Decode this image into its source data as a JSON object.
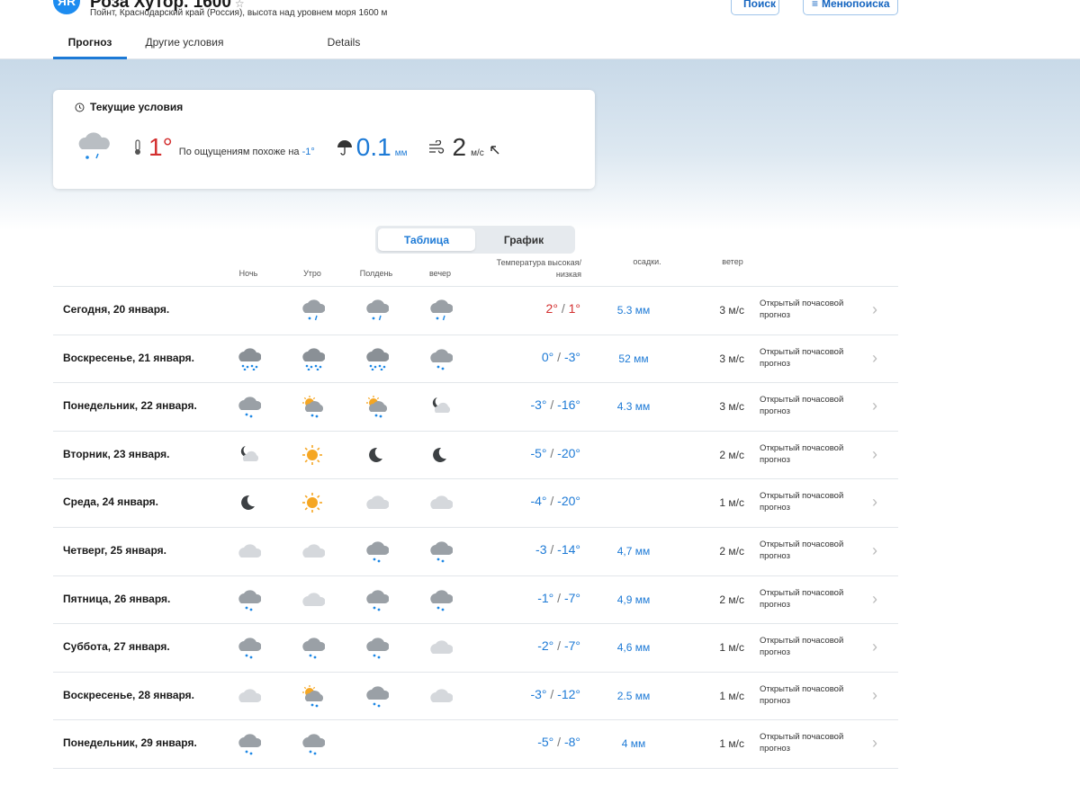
{
  "header": {
    "logo_text": "ЯR",
    "title": "Роза Хутор. 1600",
    "star": "☆",
    "subtitle": "Пойнт, Краснодарский край (Россия), высота над уровнем моря 1600 м",
    "search_label": "Поиск",
    "menu_label": "Менюпоиска"
  },
  "tabs": [
    {
      "label": "Прогноз",
      "active": true
    },
    {
      "label": "Другие условия",
      "active": false
    },
    {
      "label": "Details",
      "active": false
    }
  ],
  "current": {
    "heading": "Текущие условия",
    "icon": "cloud-light-snow-rain-icon",
    "temperature": "1°",
    "feels_like_label": "По ощущениям похоже на",
    "feels_like_value": "-1°",
    "precip_value": "0.1",
    "precip_unit": "мм",
    "wind_value": "2",
    "wind_unit": "м/с",
    "wind_direction_icon": "arrow-northwest-icon"
  },
  "view_toggle": {
    "table_label": "Таблица",
    "chart_label": "График",
    "active": "table"
  },
  "columns": {
    "night": "Ночь",
    "morning": "Утро",
    "noon": "Полдень",
    "evening": "вечер",
    "temp": "Температура высокая/\nнизкая",
    "precip": "осадки.",
    "wind": "ветер"
  },
  "days": [
    {
      "label": "Сегодня, 20 января.",
      "icons": [
        "",
        "cloud-snow-rain",
        "cloud-snow-rain",
        "cloud-snow-rain"
      ],
      "high": "2°",
      "low": "1°",
      "warm": true,
      "precip": "5.3 мм",
      "wind": "3 м/с",
      "hourly": "Открытый почасовой прогноз"
    },
    {
      "label": "Воскресенье, 21 января.",
      "icons": [
        "cloud-heavy-snow",
        "cloud-heavy-snow",
        "cloud-heavy-snow",
        "cloud-snow"
      ],
      "high": "0°",
      "low": "-3°",
      "warm": false,
      "precip": "52 мм",
      "wind": "3 м/с",
      "hourly": "Открытый почасовой прогноз"
    },
    {
      "label": "Понедельник, 22 января.",
      "icons": [
        "cloud-snow",
        "sun-cloud-snow",
        "sun-cloud-snow",
        "moon-cloud"
      ],
      "high": "-3°",
      "low": "-16°",
      "warm": false,
      "precip": "4.3 мм",
      "wind": "3 м/с",
      "hourly": "Открытый почасовой прогноз"
    },
    {
      "label": "Вторник, 23 января.",
      "icons": [
        "moon-cloud",
        "sun",
        "moon",
        "moon"
      ],
      "high": "-5°",
      "low": "-20°",
      "warm": false,
      "precip": "",
      "wind": "2 м/с",
      "hourly": "Открытый почасовой прогноз"
    },
    {
      "label": "Среда, 24 января.",
      "icons": [
        "moon",
        "sun",
        "cloud-light",
        "cloud-light"
      ],
      "high": "-4°",
      "low": "-20°",
      "warm": false,
      "precip": "",
      "wind": "1 м/с",
      "hourly": "Открытый почасовой прогноз"
    },
    {
      "label": "Четверг, 25 января.",
      "icons": [
        "cloud-light",
        "cloud-light",
        "cloud-snow",
        "cloud-snow"
      ],
      "high": "-3",
      "low": "-14°",
      "warm": false,
      "precip": "4,7 мм",
      "wind": "2 м/с",
      "hourly": "Открытый почасовой прогноз"
    },
    {
      "label": "Пятница, 26 января.",
      "icons": [
        "cloud-snow",
        "cloud-light",
        "cloud-snow",
        "cloud-snow"
      ],
      "high": "-1°",
      "low": "-7°",
      "warm": false,
      "precip": "4,9 мм",
      "wind": "2 м/с",
      "hourly": "Открытый почасовой прогноз"
    },
    {
      "label": "Суббота, 27 января.",
      "icons": [
        "cloud-snow",
        "cloud-snow",
        "cloud-snow",
        "cloud-light"
      ],
      "high": "-2°",
      "low": "-7°",
      "warm": false,
      "precip": "4,6 мм",
      "wind": "1 м/с",
      "hourly": "Открытый почасовой прогноз"
    },
    {
      "label": "Воскресенье, 28 января.",
      "icons": [
        "cloud-light",
        "sun-cloud-snow",
        "cloud-snow",
        "cloud-light"
      ],
      "high": "-3°",
      "low": "-12°",
      "warm": false,
      "precip": "2.5 мм",
      "wind": "1 м/с",
      "hourly": "Открытый почасовой прогноз"
    },
    {
      "label": "Понедельник, 29 января.",
      "icons": [
        "cloud-snow",
        "cloud-snow",
        "",
        ""
      ],
      "high": "-5°",
      "low": "-8°",
      "warm": false,
      "precip": "4 мм",
      "wind": "1 м/с",
      "hourly": "Открытый почасовой прогноз"
    }
  ],
  "colors": {
    "accent": "#1d7ad6",
    "warm": "#d32f2f",
    "cloud": "#9aa0a6",
    "snow": "#1e88e5",
    "sun": "#f5a623"
  }
}
